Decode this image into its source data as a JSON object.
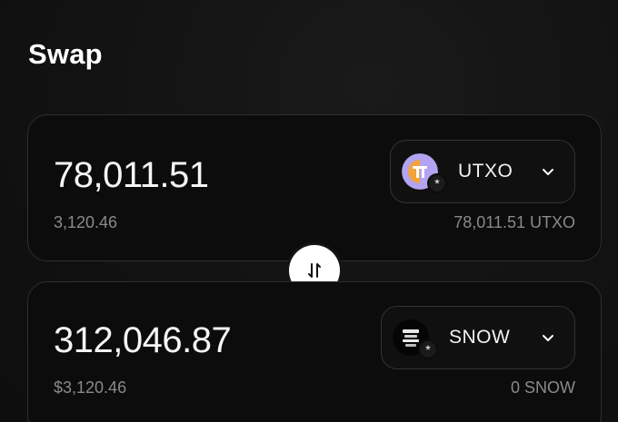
{
  "header": {
    "title": "Swap"
  },
  "from": {
    "amount": "78,011.51",
    "usd_value": "3,120.46",
    "token": {
      "symbol": "UTXO",
      "icon": "utxo-token-icon",
      "badge": "*"
    },
    "balance": "78,011.51 UTXO"
  },
  "to": {
    "amount": "312,046.87",
    "usd_value": "$3,120.46",
    "token": {
      "symbol": "SNOW",
      "icon": "snow-token-icon",
      "badge": "*"
    },
    "balance": "0 SNOW"
  },
  "swap_button": {
    "icon": "swap-arrows-icon"
  },
  "colors": {
    "background": "#121212",
    "card": "#0c0c0c",
    "border": "#2e2e2e",
    "muted_text": "#8a8a8a",
    "utxo_purple": "#b3a3f0",
    "utxo_orange": "#f2a33a"
  }
}
